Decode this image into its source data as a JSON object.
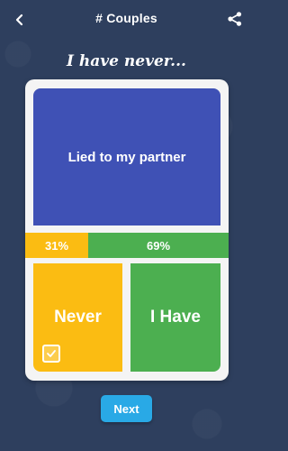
{
  "header": {
    "title": "# Couples",
    "back_icon": "back-arrow-icon",
    "share_icon": "share-icon"
  },
  "prompt": "I have never...",
  "card": {
    "question": "Lied to my partner",
    "stats": {
      "never_percent": "31%",
      "have_percent": "69%",
      "never_fraction": 0.31,
      "have_fraction": 0.69
    },
    "options": {
      "never_label": "Never",
      "have_label": "I Have",
      "selected": "never"
    }
  },
  "next_button": {
    "label": "Next"
  },
  "colors": {
    "background": "#2e3f5e",
    "question": "#3f51b5",
    "never": "#fbbc12",
    "have": "#4caf50",
    "next": "#29a9e6"
  }
}
